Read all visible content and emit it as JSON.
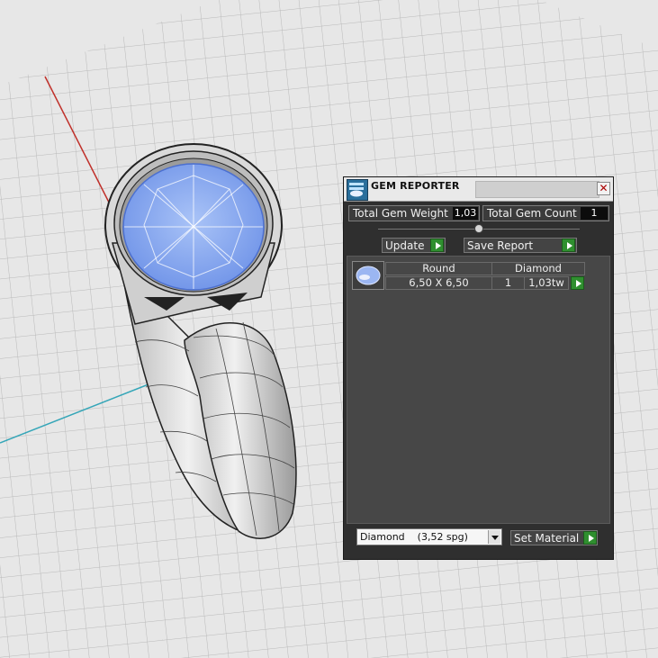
{
  "panel": {
    "title": "GEM REPORTER",
    "close_glyph": "✕",
    "total_weight_label": "Total Gem Weight",
    "total_weight_value": "1,03",
    "total_count_label": "Total Gem Count",
    "total_count_value": "1",
    "update_label": "Update",
    "save_report_label": "Save Report",
    "gem_row": {
      "shape": "Round",
      "material": "Diamond",
      "size": "6,50 X 6,50",
      "quantity": "1",
      "weight": "1,03tw"
    },
    "material_select_value": "Diamond    (3,52 spg)",
    "set_material_label": "Set Material"
  },
  "colors": {
    "gem_blue": "#8fb0f0",
    "axis_red": "#c0302a",
    "axis_cyan": "#35a6b8",
    "button_green": "#2f8f2f"
  }
}
